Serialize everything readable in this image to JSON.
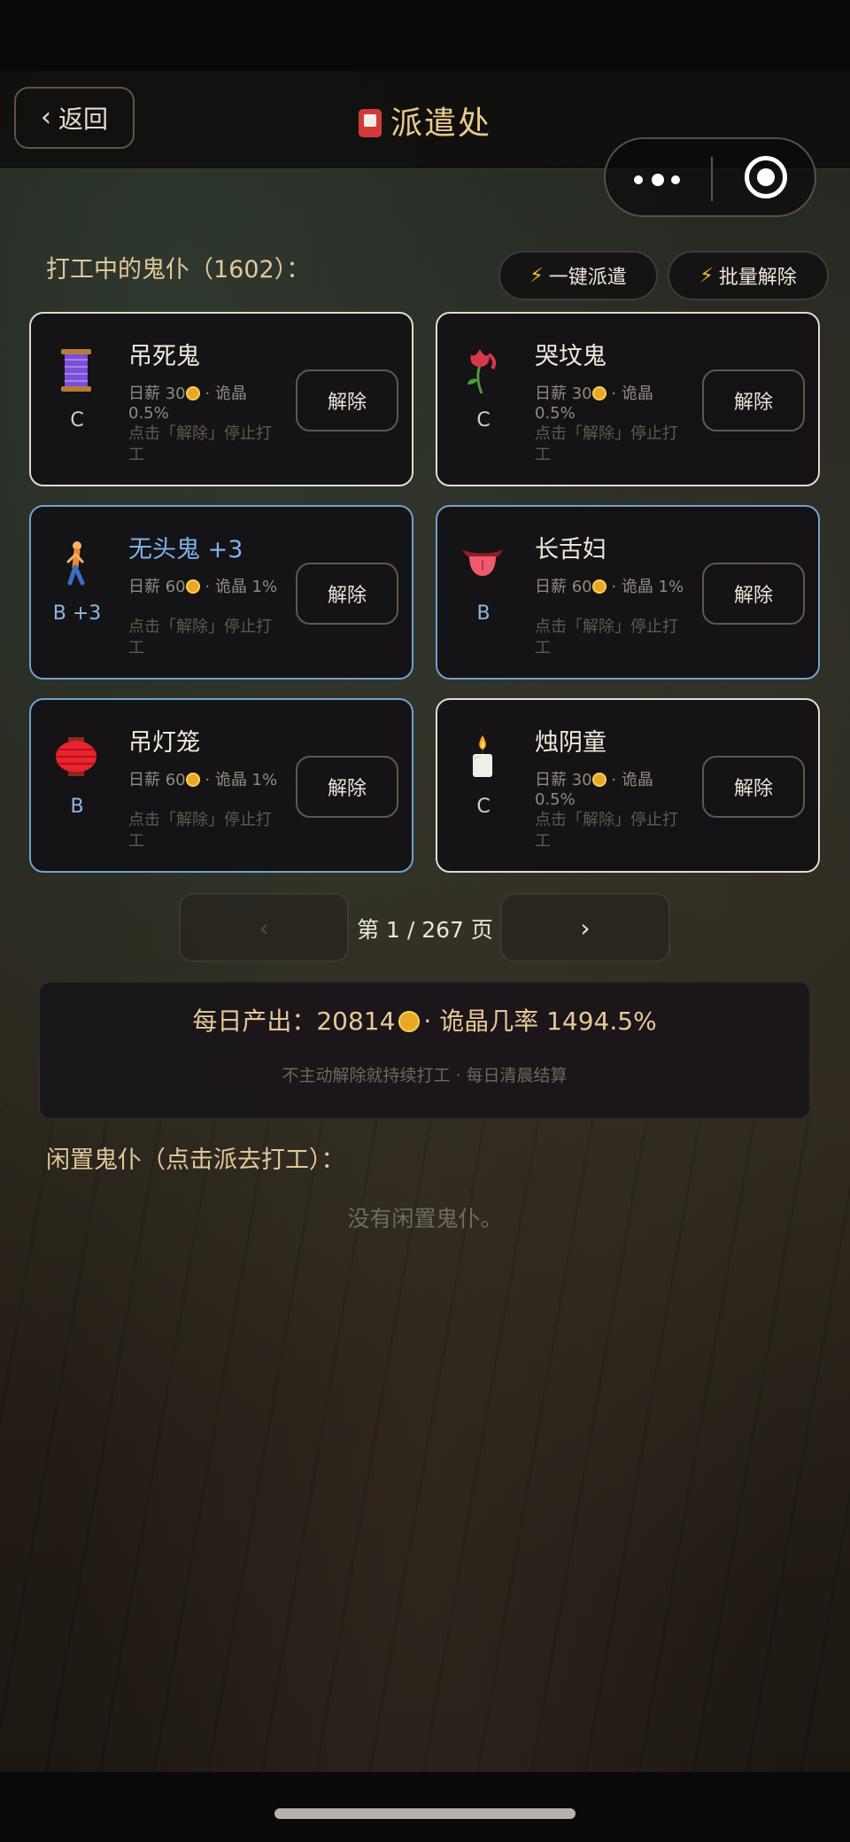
{
  "nav": {
    "back_label": "返回",
    "title": "派遣处"
  },
  "working": {
    "section_title": "打工中的鬼仆（1602）：",
    "dispatch_all_label": "一键派遣",
    "batch_dismiss_label": "批量解除"
  },
  "cards": [
    {
      "name": "吊死鬼",
      "grade": "C",
      "wage": "日薪 30",
      "crystal": "· 诡晶 0.5%",
      "hint": "点击「解除」停止打工",
      "button": "解除",
      "icon": "thread-spool-icon"
    },
    {
      "name": "哭坟鬼",
      "grade": "C",
      "wage": "日薪 30",
      "crystal": "· 诡晶 0.5%",
      "hint": "点击「解除」停止打工",
      "button": "解除",
      "icon": "wilted-flower-icon"
    },
    {
      "name": "无头鬼 +3",
      "grade": "B +3",
      "wage": "日薪 60",
      "crystal": "· 诡晶 1%",
      "hint": "点击「解除」停止打工",
      "button": "解除",
      "icon": "walking-person-icon"
    },
    {
      "name": "长舌妇",
      "grade": "B",
      "wage": "日薪 60",
      "crystal": "· 诡晶 1%",
      "hint": "点击「解除」停止打工",
      "button": "解除",
      "icon": "tongue-icon"
    },
    {
      "name": "吊灯笼",
      "grade": "B",
      "wage": "日薪 60",
      "crystal": "· 诡晶 1%",
      "hint": "点击「解除」停止打工",
      "button": "解除",
      "icon": "red-lantern-icon"
    },
    {
      "name": "烛阴童",
      "grade": "C",
      "wage": "日薪 30",
      "crystal": "· 诡晶 0.5%",
      "hint": "点击「解除」停止打工",
      "button": "解除",
      "icon": "candle-icon"
    }
  ],
  "pager": {
    "prev": "‹",
    "next": "›",
    "text": "第 1 / 267 页"
  },
  "summary": {
    "main_prefix": "每日产出：20814",
    "main_suffix": "· 诡晶几率 1494.5%",
    "sub": "不主动解除就持续打工 · 每日清晨结算"
  },
  "idle": {
    "section_title": "闲置鬼仆（点击派去打工）：",
    "empty_text": "没有闲置鬼仆。"
  },
  "colors": {
    "accent_gold": "#e2c79a",
    "rare_blue": "#6fa2cf",
    "coin": "#e8a826"
  }
}
